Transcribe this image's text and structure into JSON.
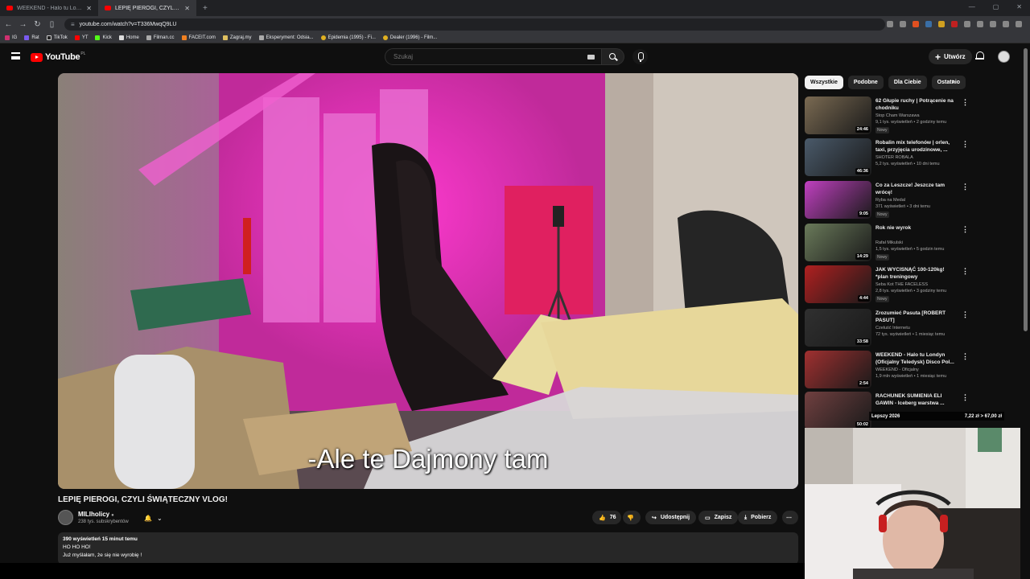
{
  "browser": {
    "tabs": [
      {
        "title": "WEEKEND - Halo tu Londyn (Oficjal",
        "active": false
      },
      {
        "title": "LEPIĘ PIEROGI, CZYLI ŚWIĄT",
        "active": true
      }
    ],
    "url": "youtube.com/watch?v=T336MwqQ9LU",
    "bookmarks": [
      "IG",
      "Rat",
      "TikTok",
      "YT",
      "Kick",
      "Home",
      "Filman.cc",
      "FACEIT.com",
      "Zagraj.my",
      "Eksperyment: Odsia...",
      "Epidemia (1995) - Fi...",
      "Dealer (1996) - Film..."
    ]
  },
  "yt": {
    "logo_text": "YouTube",
    "region": "PL",
    "search_placeholder": "Szukaj",
    "create_label": "Utwórz"
  },
  "video": {
    "subtitle": "-Ale te Dajmony tam",
    "title": "LEPIĘ PIEROGI, CZYLI ŚWIĄTECZNY VLOG!",
    "channel": "MILIholicy",
    "subscribers": "238 tys. subskrybentów",
    "likes": "76",
    "share_label": "Udostępnij",
    "save_label": "Zapisz",
    "download_label": "Pobierz",
    "desc_meta": "390 wyświetleń  15 minut temu",
    "desc_line1": "HO HO HO!",
    "desc_line2": "Już myślałam, że się nie wyrobię !"
  },
  "chips": [
    "Wszystkie",
    "Podobne",
    "Dla Ciebie",
    "Ostatnio"
  ],
  "recommendations": [
    {
      "title": "62 Głupie ruchy | Potrącenie na chodniku",
      "channel": "Stop Cham Warszawa",
      "meta": "9,1 tys. wyświetleń • 2 godziny temu",
      "badge": "Nowy",
      "duration": "24:46",
      "color": "#7a6a52"
    },
    {
      "title": "Robalin mix telefonów | orlen, taxi, przyjęcia urodzinowe, ...",
      "channel": "SHOTER ROBALA",
      "meta": "5,2 tys. wyświetleń • 10 dni temu",
      "badge": "",
      "duration": "46:36",
      "color": "#4a5a6a"
    },
    {
      "title": "Co za Leszcze! Jeszcze tam wrócę!",
      "channel": "Ryba na Medal",
      "meta": "371 wyświetleń • 3 dni temu",
      "badge": "Nowy",
      "duration": "9:05",
      "color": "#c040c0"
    },
    {
      "title": "Rok nie wyrok",
      "channel": "Rafał Mikulski",
      "meta": "1,5 tys. wyświetleń • 5 godzin temu",
      "badge": "Nowy",
      "duration": "14:29",
      "color": "#6a7a5a"
    },
    {
      "title": "JAK WYCISNĄĆ 100-120kg! *plan treningowy",
      "channel": "Seba Kot THE FACELESS",
      "meta": "2,8 tys. wyświetleń • 3 godziny temu",
      "badge": "Nowy",
      "duration": "4:44",
      "color": "#b02020"
    },
    {
      "title": "Zrozumieć Pasuta [ROBERT PASUT]",
      "channel": "Czeluść Internetu",
      "meta": "72 tys. wyświetleń • 1 miesiąc temu",
      "badge": "",
      "duration": "33:58",
      "color": "#303030"
    },
    {
      "title": "WEEKEND - Halo tu Londyn (Oficjalny Teledysk) Disco Pol...",
      "channel": "WEEKEND - Oficjalny",
      "meta": "1,9 mln wyświetleń • 1 miesiąc temu",
      "badge": "",
      "duration": "2:54",
      "color": "#a03030"
    },
    {
      "title": "RACHUNEK SUMIENIA ELI GAWIN - Iceberg warstwa ...",
      "channel": "",
      "meta": "",
      "badge": "",
      "duration": "50:02",
      "color": "#704040"
    }
  ],
  "overlay": {
    "left": "Lepszy 2026",
    "right": "7,22 zł > 67,00 zł"
  }
}
